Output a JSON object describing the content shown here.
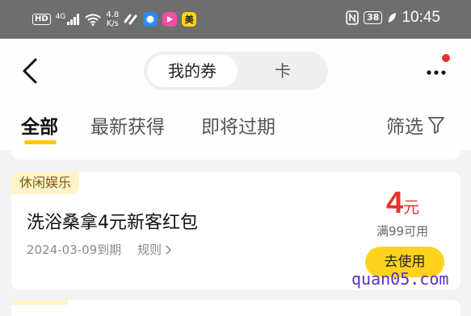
{
  "status_bar": {
    "hd": "HD",
    "network": "4G",
    "speed_value": "4.8",
    "speed_unit": "K/s",
    "app_label_mei": "美",
    "battery": "38",
    "time": "10:45"
  },
  "header": {
    "segments": [
      "我的券",
      "卡"
    ],
    "active_segment": "我的券"
  },
  "tabs": [
    {
      "label": "全部",
      "active": true
    },
    {
      "label": "最新获得",
      "active": false
    },
    {
      "label": "即将过期",
      "active": false
    }
  ],
  "filter_label": "筛选",
  "coupon": {
    "category": "休闲娱乐",
    "title": "洗浴桑拿4元新客红包",
    "amount": "4",
    "unit": "元",
    "threshold": "满99可用",
    "expiry": "2024-03-09到期",
    "rules_label": "规则",
    "use_button": "去使用"
  },
  "watermark": "quan05.com",
  "colors": {
    "accent_yellow": "#ffd21e",
    "price_red": "#e8322c",
    "tag_bg": "#fff3c9"
  }
}
